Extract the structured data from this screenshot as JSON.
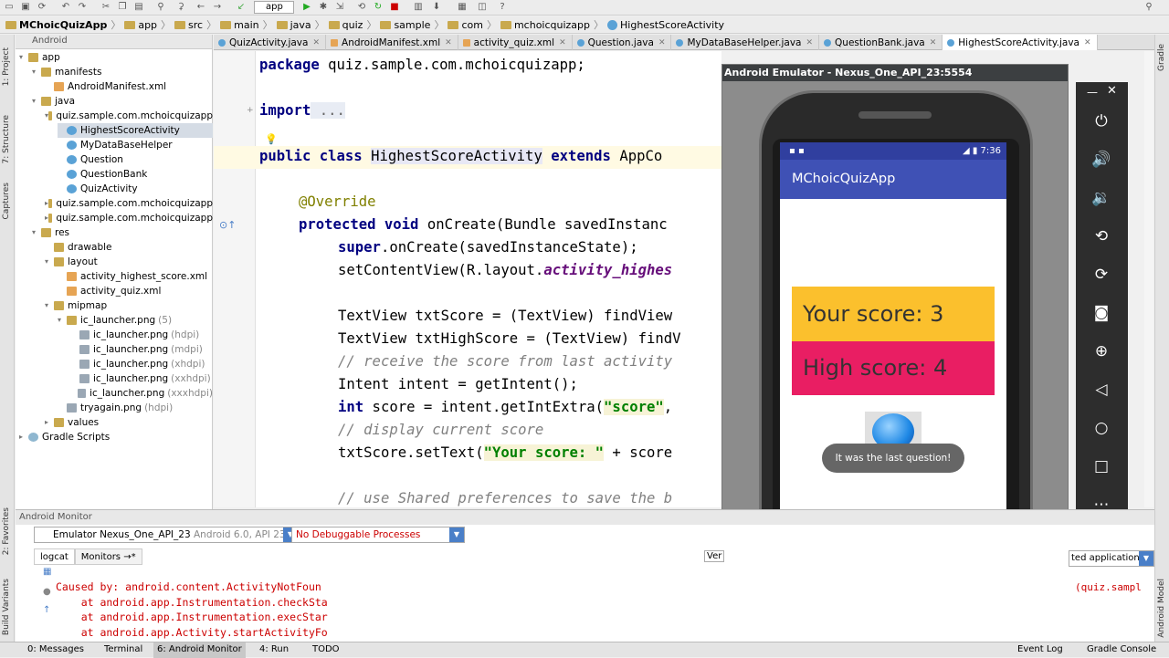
{
  "toolbar": {
    "run_config": "app"
  },
  "breadcrumb": [
    "MChoicQuizApp",
    "app",
    "src",
    "main",
    "java",
    "quiz",
    "sample",
    "com",
    "mchoicquizapp",
    "HighestScoreActivity"
  ],
  "project": {
    "view_mode": "Android",
    "tree": [
      {
        "label": "app",
        "icon": "folder",
        "hint": ""
      },
      {
        "label": "manifests",
        "icon": "folder",
        "hint": ""
      },
      {
        "label": "AndroidManifest.xml",
        "icon": "xml",
        "hint": ""
      },
      {
        "label": "java",
        "icon": "folder",
        "hint": ""
      },
      {
        "label": "quiz.sample.com.mchoicquizapp",
        "icon": "folder",
        "hint": ""
      },
      {
        "label": "HighestScoreActivity",
        "icon": "java",
        "hint": ""
      },
      {
        "label": "MyDataBaseHelper",
        "icon": "java",
        "hint": ""
      },
      {
        "label": "Question",
        "icon": "java",
        "hint": ""
      },
      {
        "label": "QuestionBank",
        "icon": "java",
        "hint": ""
      },
      {
        "label": "QuizActivity",
        "icon": "java",
        "hint": ""
      },
      {
        "label": "quiz.sample.com.mchoicquizapp",
        "icon": "folder",
        "hint": ""
      },
      {
        "label": "quiz.sample.com.mchoicquizapp",
        "icon": "folder",
        "hint": ""
      },
      {
        "label": "res",
        "icon": "folder",
        "hint": ""
      },
      {
        "label": "drawable",
        "icon": "folder",
        "hint": ""
      },
      {
        "label": "layout",
        "icon": "folder",
        "hint": ""
      },
      {
        "label": "activity_highest_score.xml",
        "icon": "xml",
        "hint": ""
      },
      {
        "label": "activity_quiz.xml",
        "icon": "xml",
        "hint": ""
      },
      {
        "label": "mipmap",
        "icon": "folder",
        "hint": ""
      },
      {
        "label": "ic_launcher.png",
        "icon": "folder",
        "hint": "(5)"
      },
      {
        "label": "ic_launcher.png",
        "icon": "png",
        "hint": "(hdpi)"
      },
      {
        "label": "ic_launcher.png",
        "icon": "png",
        "hint": "(mdpi)"
      },
      {
        "label": "ic_launcher.png",
        "icon": "png",
        "hint": "(xhdpi)"
      },
      {
        "label": "ic_launcher.png",
        "icon": "png",
        "hint": "(xxhdpi)"
      },
      {
        "label": "ic_launcher.png",
        "icon": "png",
        "hint": "(xxxhdpi)"
      },
      {
        "label": "tryagain.png",
        "icon": "png",
        "hint": "(hdpi)"
      },
      {
        "label": "values",
        "icon": "folder",
        "hint": ""
      },
      {
        "label": "Gradle Scripts",
        "icon": "gradle",
        "hint": ""
      }
    ]
  },
  "editor_tabs": [
    {
      "label": "QuizActivity.java",
      "type": "java"
    },
    {
      "label": "AndroidManifest.xml",
      "type": "xml"
    },
    {
      "label": "activity_quiz.xml",
      "type": "xml"
    },
    {
      "label": "Question.java",
      "type": "java"
    },
    {
      "label": "MyDataBaseHelper.java",
      "type": "java"
    },
    {
      "label": "QuestionBank.java",
      "type": "java"
    },
    {
      "label": "HighestScoreActivity.java",
      "type": "java"
    }
  ],
  "code": {
    "package_kw": "package",
    "package_name": " quiz.sample.com.mchoicquizapp;",
    "import_kw": "import",
    "import_fold": " ...",
    "class_kw": "public class",
    "class_name": "HighestScoreActivity",
    "extends_kw": "extends",
    "super_class": " AppCo",
    "override": "@Override",
    "protected_kw": "protected void",
    "on_create": " onCreate(Bundle savedInstanc",
    "super_kw": "super",
    "super_call": ".onCreate(savedInstanceState);",
    "set_content": "setContentView(R.layout.",
    "layout_field": "activity_highes",
    "tv1": "TextView txtScore = (TextView) findView",
    "tv2": "TextView txtHighScore = (TextView) findV",
    "comment1": "// receive the score from last activity",
    "intent_line": "Intent intent = getIntent();",
    "int_kw": "int",
    "score_line": " score = intent.getIntExtra(",
    "score_str": "\"score\"",
    "score_tail": ",",
    "comment2": "// display current score",
    "settext": "txtScore.setText(",
    "settext_str": "\"Your score: \"",
    "settext_tail": " + score",
    "comment3": "// use Shared preferences to save the b"
  },
  "emulator": {
    "title": "Android Emulator - Nexus_One_API_23:5554",
    "time": "7:36",
    "app_title": "MChoicQuizApp",
    "your_score": "Your score: 3",
    "high_score": "High score: 4",
    "toast": "It was the last question!",
    "colors": {
      "status": "#303f9f",
      "appbar": "#3f51b5",
      "score": "#fbc02d",
      "high": "#e91e63"
    }
  },
  "monitor": {
    "title": "Android Monitor",
    "device": "Emulator Nexus_One_API_23",
    "device_hint": "Android 6.0, API 23",
    "process": "No Debuggable Processes",
    "tabs": [
      "logcat",
      "Monitors →*"
    ],
    "right_select": "ted application",
    "log_lines": [
      "Caused by: android.content.ActivityNotFoun",
      "    at android.app.Instrumentation.checkSta",
      "    at android.app.Instrumentation.execStar",
      "    at android.app.Activity.startActivityFo"
    ],
    "log_right": "(quiz.sampl",
    "ver_label": "Ver"
  },
  "bottom_bar": {
    "messages": "0: Messages",
    "terminal": "Terminal",
    "monitor": "6: Android Monitor",
    "run": "4: Run",
    "todo": "TODO",
    "event_log": "Event Log",
    "gradle_console": "Gradle Console"
  },
  "left_strip": {
    "project": "1: Project",
    "structure": "7: Structure",
    "captures": "Captures",
    "favorites": "2: Favorites",
    "build_variants": "Build Variants"
  },
  "right_strip": {
    "gradle": "Gradle",
    "android_model": "Android Model"
  }
}
